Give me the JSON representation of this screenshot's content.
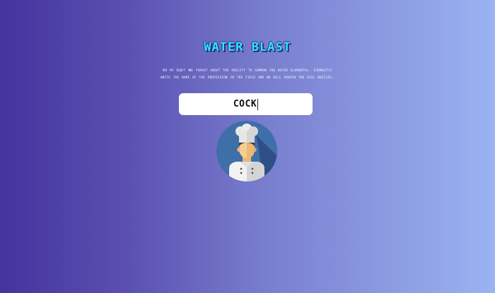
{
  "game": {
    "title": "WATER BLAST",
    "description": "Oh my God! We forgot about the ability to summon the water elemental. Correctly write the name of the profession in the field and we will punish the evil beetles.",
    "answer_value": "COCK"
  },
  "avatar": {
    "icon": "chef-icon",
    "colors": {
      "circle": "#3f6fa8",
      "shadow": "#2e4f86",
      "hat": "#d9d9d9",
      "skin": "#f6cf90",
      "hair": "#3a3a3a",
      "coat": "#f2f2f2"
    }
  },
  "colors": {
    "background_start": "#45339e",
    "background_end": "#9bb3f2",
    "title": "#38e6f4"
  }
}
